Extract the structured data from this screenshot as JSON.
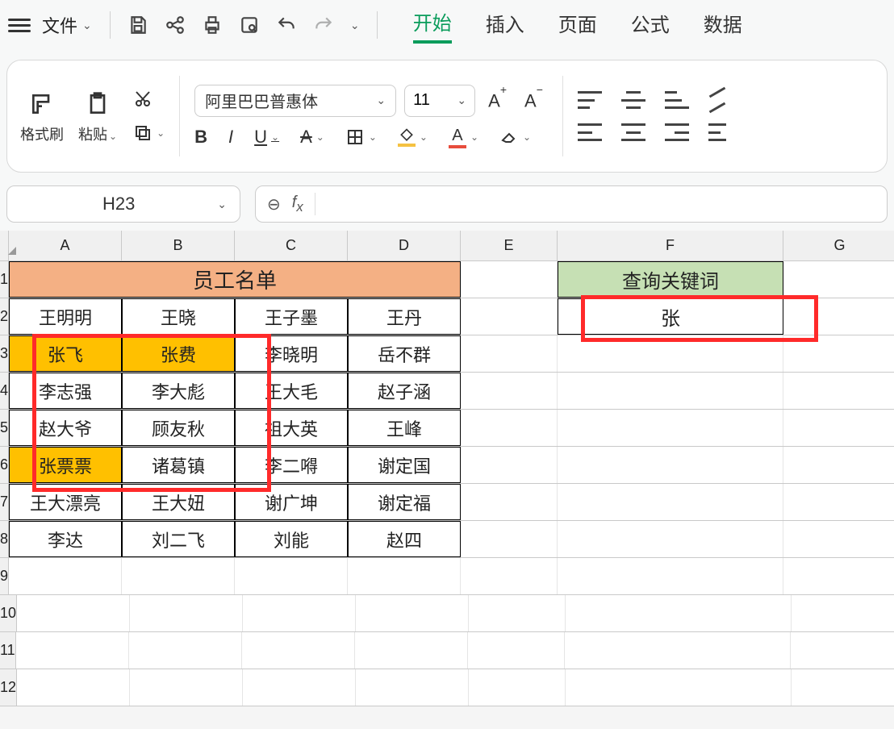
{
  "menu": {
    "file": "文件",
    "tabs": [
      "开始",
      "插入",
      "页面",
      "公式",
      "数据"
    ],
    "active_tab": 0
  },
  "ribbon": {
    "format_painter": "格式刷",
    "paste": "粘贴",
    "font_name": "阿里巴巴普惠体",
    "font_size": "11"
  },
  "namebox": "H23",
  "formula": "",
  "columns": [
    "A",
    "B",
    "C",
    "D",
    "E",
    "F",
    "G"
  ],
  "rows": [
    "1",
    "2",
    "3",
    "4",
    "5",
    "6",
    "7",
    "8",
    "9",
    "10",
    "11",
    "12"
  ],
  "table": {
    "title": "员工名单",
    "data": [
      [
        "王明明",
        "王晓",
        "王子墨",
        "王丹"
      ],
      [
        "张飞",
        "张费",
        "李晓明",
        "岳不群"
      ],
      [
        "李志强",
        "李大彪",
        "王大毛",
        "赵子涵"
      ],
      [
        "赵大爷",
        "顾友秋",
        "祖大英",
        "王峰"
      ],
      [
        "张票票",
        "诸葛镇",
        "李二嘚",
        "谢定国"
      ],
      [
        "王大漂亮",
        "王大妞",
        "谢广坤",
        "谢定福"
      ],
      [
        "李达",
        "刘二飞",
        "刘能",
        "赵四"
      ]
    ],
    "highlighted": [
      [
        1,
        0
      ],
      [
        1,
        1
      ],
      [
        4,
        0
      ]
    ]
  },
  "keyword": {
    "header": "查询关键词",
    "value": "张"
  },
  "colors": {
    "tab_active": "#0a9c5b",
    "header_bg": "#f4b084",
    "highlight_bg": "#ffc000",
    "keyword_bg": "#c6e0b4",
    "annotation": "#ff2a2a"
  },
  "chart_data": {
    "type": "table",
    "title": "员工名单",
    "columns": [
      "A",
      "B",
      "C",
      "D"
    ],
    "rows": [
      [
        "王明明",
        "王晓",
        "王子墨",
        "王丹"
      ],
      [
        "张飞",
        "张费",
        "李晓明",
        "岳不群"
      ],
      [
        "李志强",
        "李大彪",
        "王大毛",
        "赵子涵"
      ],
      [
        "赵大爷",
        "顾友秋",
        "祖大英",
        "王峰"
      ],
      [
        "张票票",
        "诸葛镇",
        "李二嘚",
        "谢定国"
      ],
      [
        "王大漂亮",
        "王大妞",
        "谢广坤",
        "谢定福"
      ],
      [
        "李达",
        "刘二飞",
        "刘能",
        "赵四"
      ]
    ],
    "lookup": {
      "header": "查询关键词",
      "value": "张"
    }
  }
}
